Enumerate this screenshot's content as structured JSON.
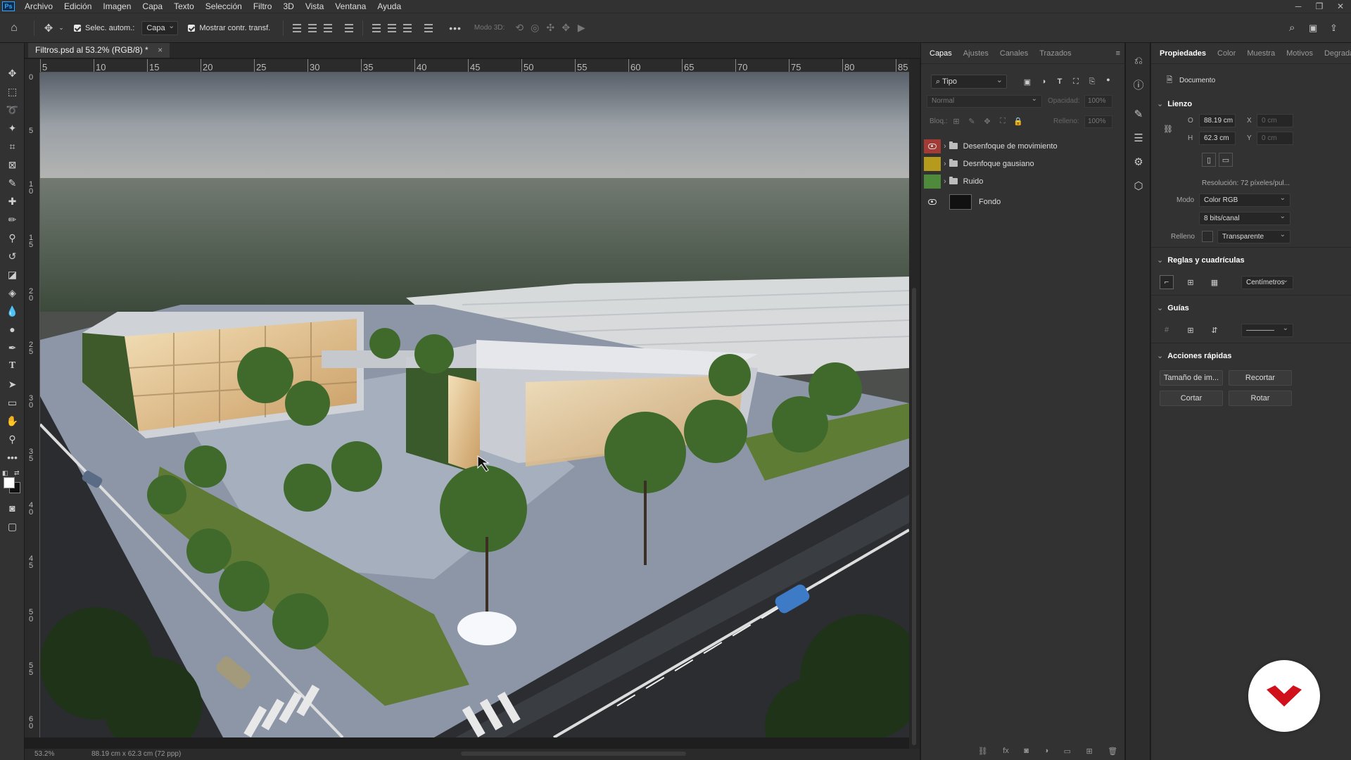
{
  "app": {
    "logo": "Ps",
    "menu": [
      "Archivo",
      "Edición",
      "Imagen",
      "Capa",
      "Texto",
      "Selección",
      "Filtro",
      "3D",
      "Vista",
      "Ventana",
      "Ayuda"
    ]
  },
  "options_bar": {
    "auto_select_label": "Selec. autom.:",
    "auto_select_target": "Capa",
    "show_transform_label": "Mostrar contr. transf.",
    "mode_3d_label": "Modo 3D:",
    "more": "•••"
  },
  "document": {
    "tab_title": "Filtros.psd al 53.2% (RGB/8) *",
    "ruler_h": [
      "5",
      "10",
      "15",
      "20",
      "25",
      "30",
      "35",
      "40",
      "45",
      "50",
      "55",
      "60",
      "65",
      "70",
      "75",
      "80",
      "85"
    ],
    "ruler_v": [
      "0",
      "5",
      "1 0",
      "1 5",
      "2 0",
      "2 5",
      "3 0",
      "3 5",
      "4 0",
      "4 5",
      "5 0",
      "5 5",
      "6 0"
    ],
    "status": "53.2%",
    "status_doc": "88.19 cm x 62.3 cm (72 ppp)"
  },
  "layers_panel": {
    "tabs": [
      "Capas",
      "Ajustes",
      "Canales",
      "Trazados"
    ],
    "filter_kind": "Tipo",
    "blend_mode": "Normal",
    "opacity_label": "Opacidad:",
    "opacity_value": "100%",
    "lock_label": "Bloq.:",
    "fill_label": "Relleno:",
    "fill_value": "100%",
    "layers": [
      {
        "name": "Desenfoque de movimiento",
        "type": "group",
        "visible": true,
        "color": "#a23a36"
      },
      {
        "name": "Desnfoque gausiano",
        "type": "group",
        "visible": false,
        "color": "#b59a1b"
      },
      {
        "name": "Ruido",
        "type": "group",
        "visible": false,
        "color": "#4f8a3c"
      },
      {
        "name": "Fondo",
        "type": "layer",
        "visible": true,
        "color": ""
      }
    ]
  },
  "properties_panel": {
    "tabs": [
      "Propiedades",
      "Color",
      "Muestra",
      "Motivos",
      "Degrada"
    ],
    "doc_label": "Documento",
    "canvas": {
      "title": "Lienzo",
      "w_label": "O",
      "w_value": "88.19 cm",
      "h_label": "H",
      "h_value": "62.3 cm",
      "x_label": "X",
      "x_value": "0 cm",
      "y_label": "Y",
      "y_value": "0 cm",
      "resolution": "Resolución: 72 píxeles/pul...",
      "mode_label": "Modo",
      "mode_value": "Color RGB",
      "depth_value": "8 bits/canal",
      "fill_label": "Relleno",
      "fill_value": "Transparente"
    },
    "rulers": {
      "title": "Reglas y cuadrículas",
      "units": "Centímetros"
    },
    "guides": {
      "title": "Guías",
      "line_style": "————"
    },
    "quick_actions": {
      "title": "Acciones rápidas",
      "buttons": [
        "Tamaño de im...",
        "Recortar",
        "Cortar",
        "Rotar"
      ]
    }
  },
  "colors": {
    "accent": "#31a8ff",
    "brand": "#d0101a"
  }
}
